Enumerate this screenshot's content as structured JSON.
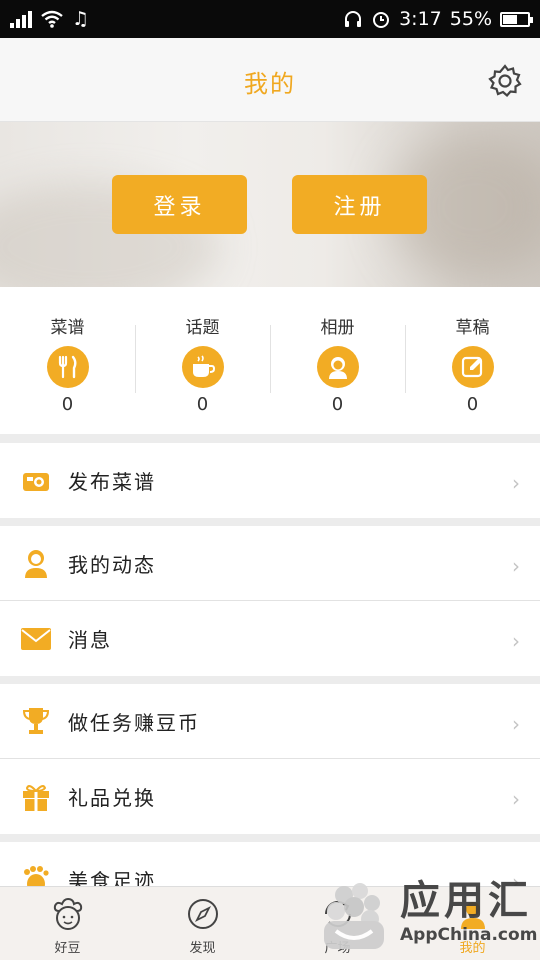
{
  "status_bar": {
    "time": "3:17",
    "battery": "55%"
  },
  "header": {
    "title": "我的"
  },
  "banner": {
    "login_label": "登录",
    "register_label": "注册"
  },
  "stats": [
    {
      "label": "菜谱",
      "value": "0",
      "icon": "fork-knife-icon"
    },
    {
      "label": "话题",
      "value": "0",
      "icon": "coffee-cup-icon"
    },
    {
      "label": "相册",
      "value": "0",
      "icon": "person-icon"
    },
    {
      "label": "草稿",
      "value": "0",
      "icon": "edit-icon"
    }
  ],
  "menu": [
    {
      "label": "发布菜谱",
      "icon": "camera-icon"
    },
    {
      "label": "我的动态",
      "icon": "user-icon"
    },
    {
      "label": "消息",
      "icon": "envelope-icon"
    },
    {
      "label": "做任务赚豆币",
      "icon": "trophy-icon"
    },
    {
      "label": "礼品兑换",
      "icon": "gift-icon"
    },
    {
      "label": "美食足迹",
      "icon": "footprint-icon"
    }
  ],
  "tabs": [
    {
      "label": "好豆",
      "icon": "chef-icon"
    },
    {
      "label": "发现",
      "icon": "compass-icon"
    },
    {
      "label": "广场",
      "icon": "square-icon"
    },
    {
      "label": "我的",
      "icon": "me-icon",
      "active": true
    }
  ],
  "watermark": {
    "cn": "应用汇",
    "en": "AppChina.com"
  },
  "colors": {
    "accent": "#f2ac24",
    "title": "#f0a820"
  }
}
